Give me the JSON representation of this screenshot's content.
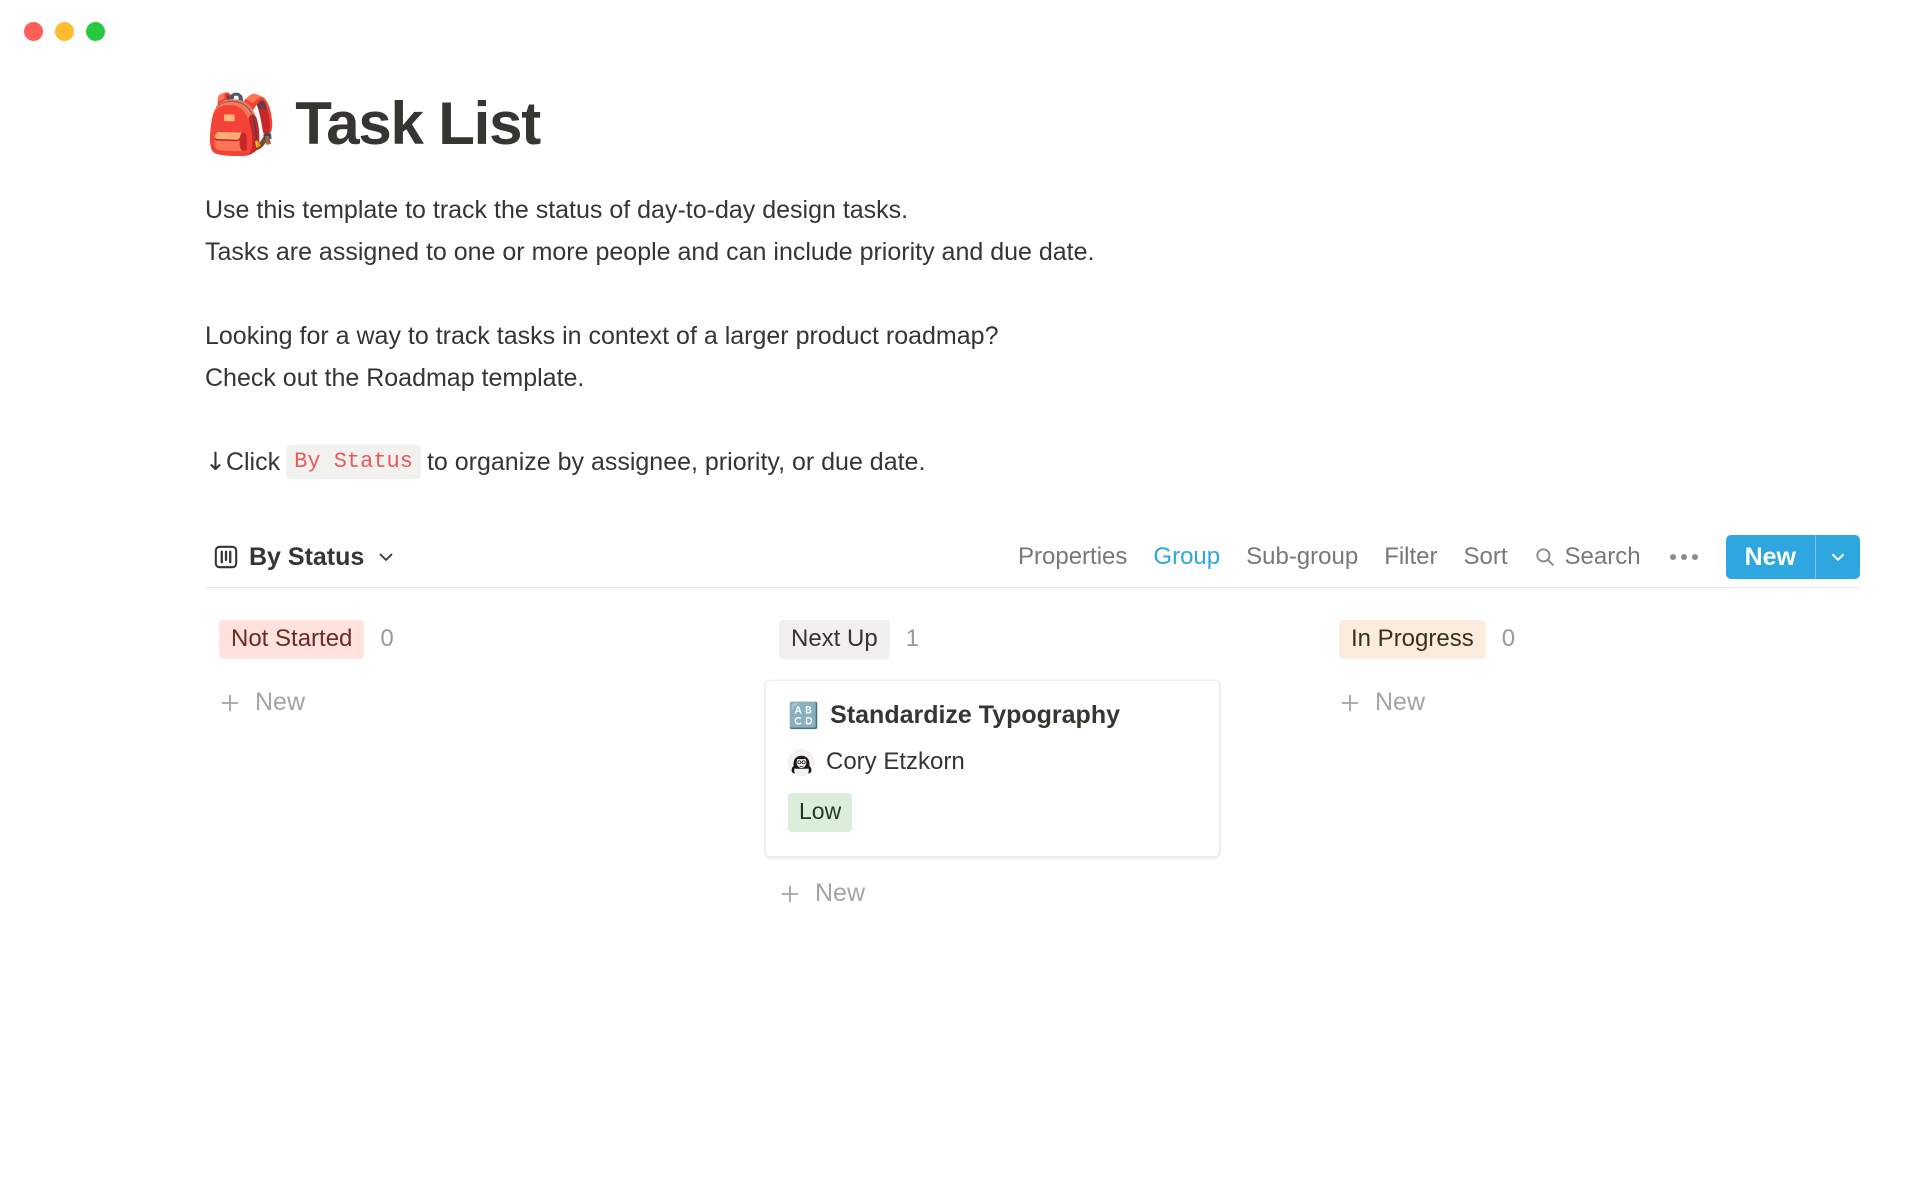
{
  "window": {
    "traffic_lights": [
      {
        "name": "close",
        "color": "#ff5f57"
      },
      {
        "name": "minimize",
        "color": "#ffbd2e"
      },
      {
        "name": "maximize",
        "color": "#28c840"
      }
    ]
  },
  "page": {
    "emoji": "🎒",
    "title": "Task List",
    "paragraphs": [
      "Use this template to track the status of day-to-day design tasks.",
      "Tasks are assigned to one or more people and can include priority and due date.",
      "Looking for a way to track tasks in context of a larger product roadmap?",
      "Check out the Roadmap template."
    ],
    "hint": {
      "arrow": "↓",
      "before": " Click ",
      "code": "By Status",
      "after": " to organize by assignee, priority, or due date."
    }
  },
  "toolbar": {
    "view_label": "By Status",
    "view_icon": "board-view-icon",
    "caret_icon": "chevron-down-icon",
    "items": [
      {
        "label": "Properties",
        "active": false
      },
      {
        "label": "Group",
        "active": true
      },
      {
        "label": "Sub-group",
        "active": false
      },
      {
        "label": "Filter",
        "active": false
      },
      {
        "label": "Sort",
        "active": false
      }
    ],
    "search_label": "Search",
    "search_icon": "search-icon",
    "more_icon": "ellipsis-icon",
    "new_label": "New",
    "new_caret_icon": "chevron-down-icon",
    "accent_color": "#2ea7e0"
  },
  "board": {
    "columns": [
      {
        "status": "Not Started",
        "count": "0",
        "pill_bg": "#ffe2dd",
        "pill_color": "#6e2b22",
        "add_label": "New",
        "cards": []
      },
      {
        "status": "Next Up",
        "count": "1",
        "pill_bg": "#f1f0ef",
        "pill_color": "#37352f",
        "add_label": "New",
        "cards": [
          {
            "emoji": "🔠",
            "title": "Standardize Typography",
            "assignee": "Cory Etzkorn",
            "priority": "Low",
            "priority_bg": "#dbeddb",
            "priority_color": "#1c3829"
          }
        ]
      },
      {
        "status": "In Progress",
        "count": "0",
        "pill_bg": "#fbecdd",
        "pill_color": "#402c1b",
        "add_label": "New",
        "cards": []
      }
    ]
  }
}
